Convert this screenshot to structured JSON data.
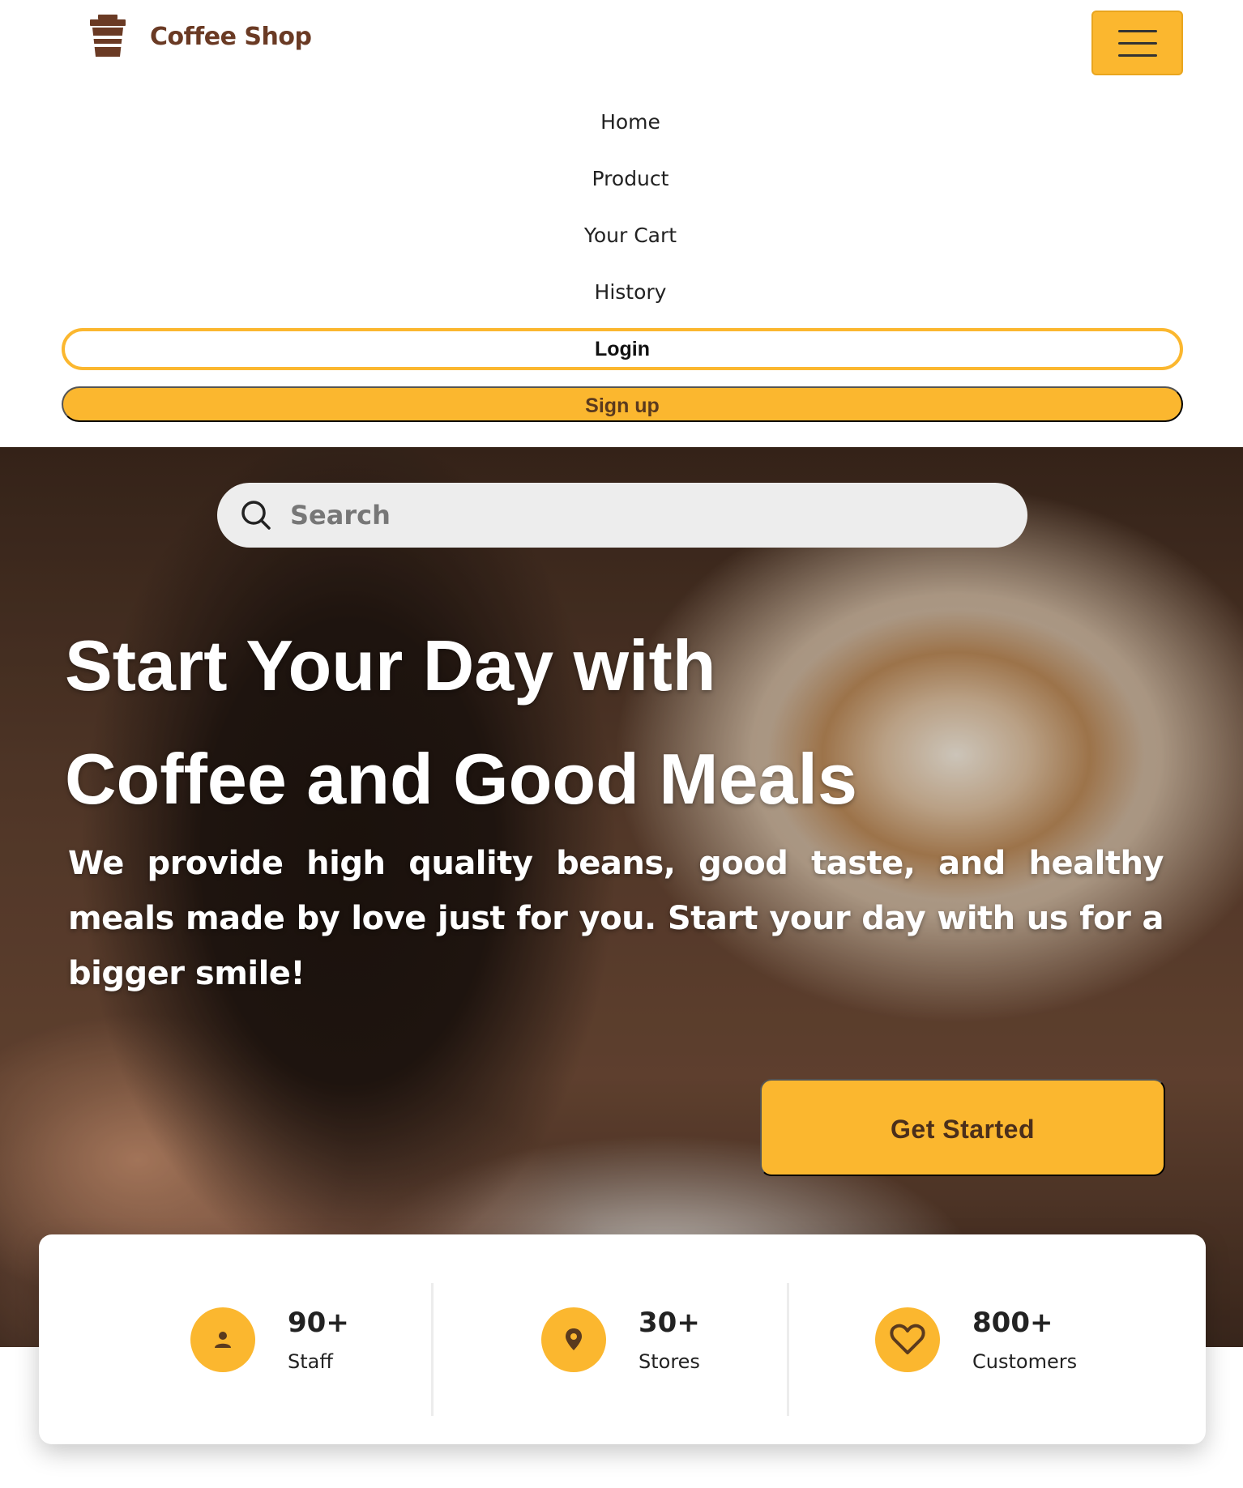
{
  "brand": {
    "name": "Coffee Shop"
  },
  "nav": {
    "links": [
      "Home",
      "Product",
      "Your Cart",
      "History"
    ],
    "login_label": "Login",
    "signup_label": "Sign up"
  },
  "hero": {
    "search_placeholder": "Search",
    "title_line1": "Start Your Day with",
    "title_line2": "Coffee and Good Meals",
    "text": "We provide high quality beans, good taste, and healthy meals made by love just for you. Start your day with us for a bigger smile!",
    "cta_label": "Get Started"
  },
  "stats": [
    {
      "value": "90+",
      "label": "Staff",
      "icon": "person-icon"
    },
    {
      "value": "30+",
      "label": "Stores",
      "icon": "location-pin-icon"
    },
    {
      "value": "800+",
      "label": "Customers",
      "icon": "heart-icon"
    }
  ],
  "colors": {
    "accent": "#fbb72f",
    "brand": "#6a3a24"
  }
}
